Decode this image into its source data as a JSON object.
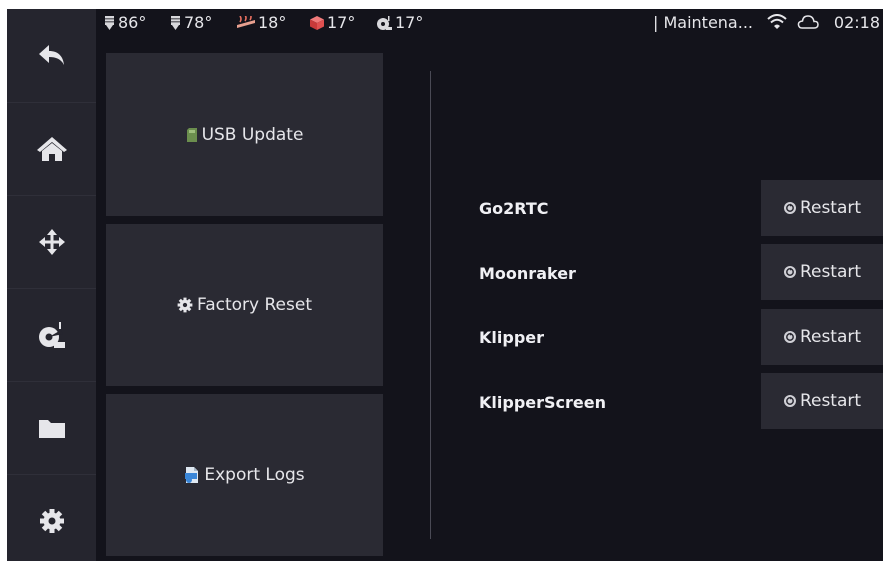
{
  "topbar": {
    "temps": [
      {
        "icon": "extruder-icon",
        "value": "86°"
      },
      {
        "icon": "extruder-icon",
        "value": "78°"
      },
      {
        "icon": "heater-bed-icon",
        "value": "18°"
      },
      {
        "icon": "chamber-icon",
        "value": "17°"
      },
      {
        "icon": "mcu-icon",
        "value": "17°"
      }
    ],
    "title": "| Maintena...",
    "clock": "02:18"
  },
  "sidebar": {
    "items": [
      {
        "icon": "back-arrow-icon"
      },
      {
        "icon": "home-icon"
      },
      {
        "icon": "move-icon"
      },
      {
        "icon": "extrude-icon"
      },
      {
        "icon": "folder-icon"
      },
      {
        "icon": "gear-icon"
      }
    ]
  },
  "actions": {
    "usb_update": "USB Update",
    "factory_reset": "Factory Reset",
    "export_logs": "Export Logs"
  },
  "services": [
    {
      "name": "Go2RTC",
      "button": "Restart"
    },
    {
      "name": "Moonraker",
      "button": "Restart"
    },
    {
      "name": "Klipper",
      "button": "Restart"
    },
    {
      "name": "KlipperScreen",
      "button": "Restart"
    }
  ],
  "colors": {
    "background": "#13131b",
    "panel": "#2a2a33",
    "sidebar": "#25252e",
    "text": "#e6e6ea"
  }
}
